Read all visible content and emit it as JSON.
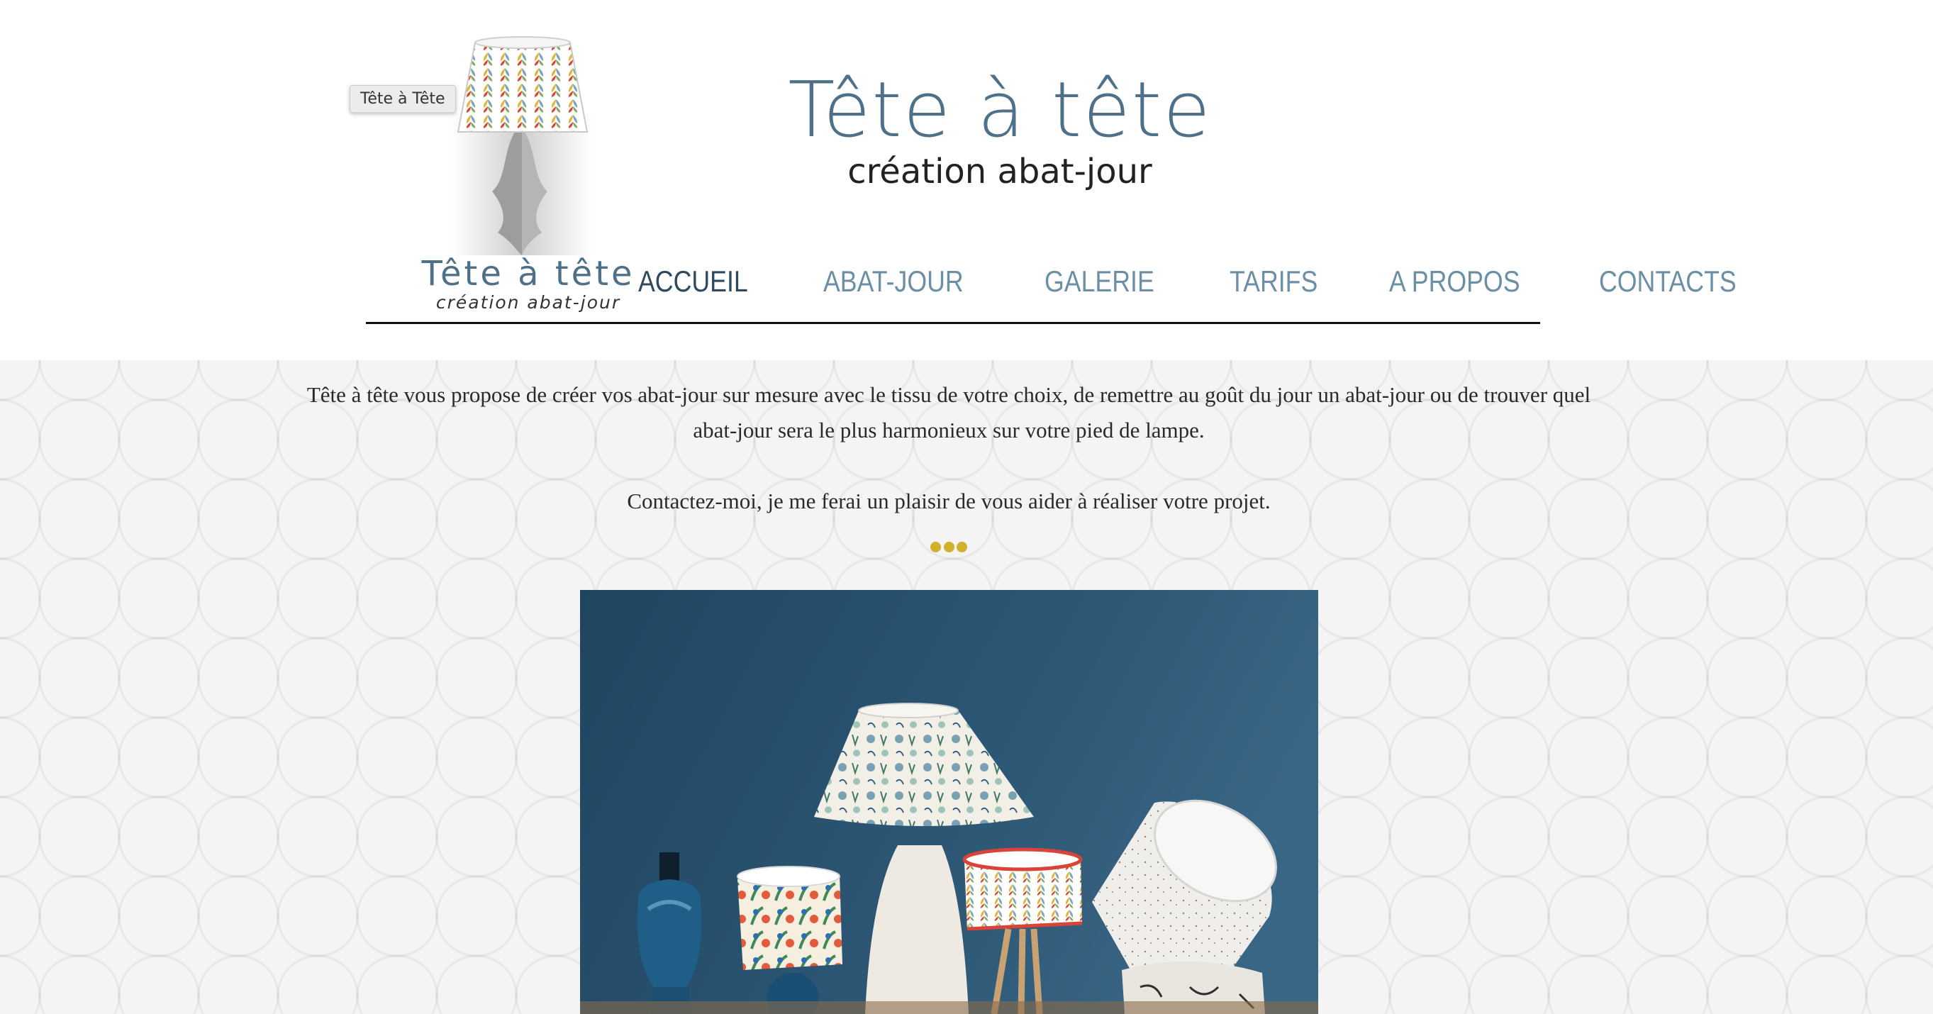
{
  "tooltip": "Tête à Tête",
  "logo": {
    "caption_title": "Tête à tête",
    "caption_subtitle": "création abat-jour"
  },
  "site": {
    "title": "Tête à tête",
    "subtitle": "création abat-jour"
  },
  "nav": {
    "items": [
      {
        "label": "ACCUEIL",
        "active": true
      },
      {
        "label": "ABAT-JOUR",
        "active": false
      },
      {
        "label": "GALERIE",
        "active": false
      },
      {
        "label": "TARIFS",
        "active": false
      },
      {
        "label": "A PROPOS",
        "active": false
      },
      {
        "label": "CONTACTS",
        "active": false
      }
    ]
  },
  "content": {
    "intro": "Tête à tête vous propose de créer vos abat-jour sur mesure avec le tissu de votre choix, de remettre au goût du jour un abat-jour ou de trouver quel abat-jour sera le plus harmonieux sur votre pied de lampe.",
    "contact_line": "Contactez-moi, je me ferai un plaisir de vous aider à réaliser votre projet."
  },
  "colors": {
    "brand_blue": "#4e7189",
    "nav_text": "#6b8fa4",
    "nav_active": "#2f4a5f",
    "accent_dots": "#d2b02c",
    "wall": "#2f5a78"
  },
  "icons": [
    "lampshade-face-logo",
    "separator-dots"
  ]
}
